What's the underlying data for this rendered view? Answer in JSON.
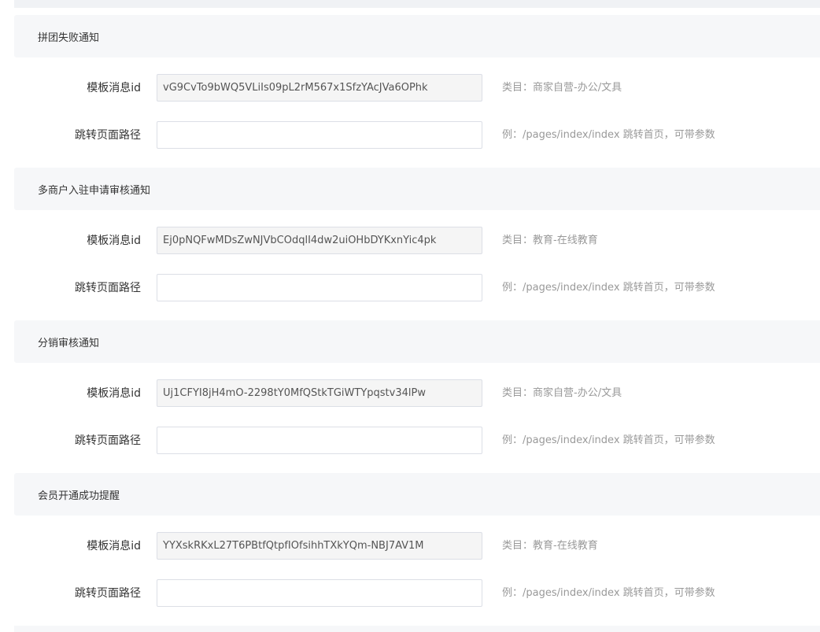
{
  "sections": [
    {
      "title": "拼团失败通知",
      "template_label": "模板消息id",
      "template_value": "vG9CvTo9bWQ5VLiIs09pL2rM567x1SfzYAcJVa6OPhk",
      "template_hint": "类目：商家自营-办公/文具",
      "path_label": "跳转页面路径",
      "path_value": "",
      "path_hint": "例：/pages/index/index 跳转首页，可带参数"
    },
    {
      "title": "多商户入驻申请审核通知",
      "template_label": "模板消息id",
      "template_value": "Ej0pNQFwMDsZwNJVbCOdqlI4dw2uiOHbDYKxnYic4pk",
      "template_hint": "类目：教育-在线教育",
      "path_label": "跳转页面路径",
      "path_value": "",
      "path_hint": "例：/pages/index/index 跳转首页，可带参数"
    },
    {
      "title": "分销审核通知",
      "template_label": "模板消息id",
      "template_value": "Uj1CFYI8jH4mO-2298tY0MfQStkTGiWTYpqstv34lPw",
      "template_hint": "类目：商家自营-办公/文具",
      "path_label": "跳转页面路径",
      "path_value": "",
      "path_hint": "例：/pages/index/index 跳转首页，可带参数"
    },
    {
      "title": "会员开通成功提醒",
      "template_label": "模板消息id",
      "template_value": "YYXskRKxL27T6PBtfQtpfIOfsihhTXkYQm-NBJ7AV1M",
      "template_hint": "类目：教育-在线教育",
      "path_label": "跳转页面路径",
      "path_value": "",
      "path_hint": "例：/pages/index/index 跳转首页，可带参数"
    }
  ]
}
